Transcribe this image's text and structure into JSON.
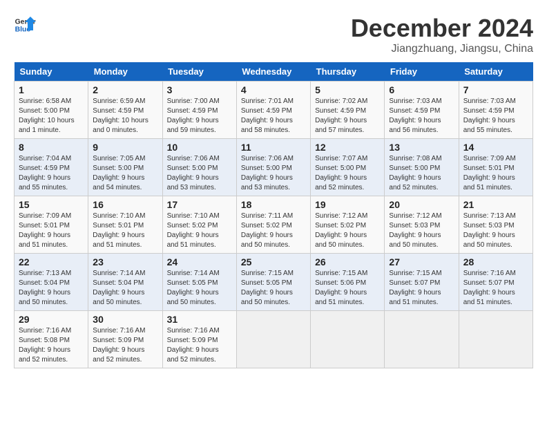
{
  "header": {
    "logo_line1": "General",
    "logo_line2": "Blue",
    "month_title": "December 2024",
    "location": "Jiangzhuang, Jiangsu, China"
  },
  "weekdays": [
    "Sunday",
    "Monday",
    "Tuesday",
    "Wednesday",
    "Thursday",
    "Friday",
    "Saturday"
  ],
  "weeks": [
    [
      {
        "day": "1",
        "sunrise": "Sunrise: 6:58 AM",
        "sunset": "Sunset: 5:00 PM",
        "daylight": "Daylight: 10 hours and 1 minute."
      },
      {
        "day": "2",
        "sunrise": "Sunrise: 6:59 AM",
        "sunset": "Sunset: 4:59 PM",
        "daylight": "Daylight: 10 hours and 0 minutes."
      },
      {
        "day": "3",
        "sunrise": "Sunrise: 7:00 AM",
        "sunset": "Sunset: 4:59 PM",
        "daylight": "Daylight: 9 hours and 59 minutes."
      },
      {
        "day": "4",
        "sunrise": "Sunrise: 7:01 AM",
        "sunset": "Sunset: 4:59 PM",
        "daylight": "Daylight: 9 hours and 58 minutes."
      },
      {
        "day": "5",
        "sunrise": "Sunrise: 7:02 AM",
        "sunset": "Sunset: 4:59 PM",
        "daylight": "Daylight: 9 hours and 57 minutes."
      },
      {
        "day": "6",
        "sunrise": "Sunrise: 7:03 AM",
        "sunset": "Sunset: 4:59 PM",
        "daylight": "Daylight: 9 hours and 56 minutes."
      },
      {
        "day": "7",
        "sunrise": "Sunrise: 7:03 AM",
        "sunset": "Sunset: 4:59 PM",
        "daylight": "Daylight: 9 hours and 55 minutes."
      }
    ],
    [
      {
        "day": "8",
        "sunrise": "Sunrise: 7:04 AM",
        "sunset": "Sunset: 4:59 PM",
        "daylight": "Daylight: 9 hours and 55 minutes."
      },
      {
        "day": "9",
        "sunrise": "Sunrise: 7:05 AM",
        "sunset": "Sunset: 5:00 PM",
        "daylight": "Daylight: 9 hours and 54 minutes."
      },
      {
        "day": "10",
        "sunrise": "Sunrise: 7:06 AM",
        "sunset": "Sunset: 5:00 PM",
        "daylight": "Daylight: 9 hours and 53 minutes."
      },
      {
        "day": "11",
        "sunrise": "Sunrise: 7:06 AM",
        "sunset": "Sunset: 5:00 PM",
        "daylight": "Daylight: 9 hours and 53 minutes."
      },
      {
        "day": "12",
        "sunrise": "Sunrise: 7:07 AM",
        "sunset": "Sunset: 5:00 PM",
        "daylight": "Daylight: 9 hours and 52 minutes."
      },
      {
        "day": "13",
        "sunrise": "Sunrise: 7:08 AM",
        "sunset": "Sunset: 5:00 PM",
        "daylight": "Daylight: 9 hours and 52 minutes."
      },
      {
        "day": "14",
        "sunrise": "Sunrise: 7:09 AM",
        "sunset": "Sunset: 5:01 PM",
        "daylight": "Daylight: 9 hours and 51 minutes."
      }
    ],
    [
      {
        "day": "15",
        "sunrise": "Sunrise: 7:09 AM",
        "sunset": "Sunset: 5:01 PM",
        "daylight": "Daylight: 9 hours and 51 minutes."
      },
      {
        "day": "16",
        "sunrise": "Sunrise: 7:10 AM",
        "sunset": "Sunset: 5:01 PM",
        "daylight": "Daylight: 9 hours and 51 minutes."
      },
      {
        "day": "17",
        "sunrise": "Sunrise: 7:10 AM",
        "sunset": "Sunset: 5:02 PM",
        "daylight": "Daylight: 9 hours and 51 minutes."
      },
      {
        "day": "18",
        "sunrise": "Sunrise: 7:11 AM",
        "sunset": "Sunset: 5:02 PM",
        "daylight": "Daylight: 9 hours and 50 minutes."
      },
      {
        "day": "19",
        "sunrise": "Sunrise: 7:12 AM",
        "sunset": "Sunset: 5:02 PM",
        "daylight": "Daylight: 9 hours and 50 minutes."
      },
      {
        "day": "20",
        "sunrise": "Sunrise: 7:12 AM",
        "sunset": "Sunset: 5:03 PM",
        "daylight": "Daylight: 9 hours and 50 minutes."
      },
      {
        "day": "21",
        "sunrise": "Sunrise: 7:13 AM",
        "sunset": "Sunset: 5:03 PM",
        "daylight": "Daylight: 9 hours and 50 minutes."
      }
    ],
    [
      {
        "day": "22",
        "sunrise": "Sunrise: 7:13 AM",
        "sunset": "Sunset: 5:04 PM",
        "daylight": "Daylight: 9 hours and 50 minutes."
      },
      {
        "day": "23",
        "sunrise": "Sunrise: 7:14 AM",
        "sunset": "Sunset: 5:04 PM",
        "daylight": "Daylight: 9 hours and 50 minutes."
      },
      {
        "day": "24",
        "sunrise": "Sunrise: 7:14 AM",
        "sunset": "Sunset: 5:05 PM",
        "daylight": "Daylight: 9 hours and 50 minutes."
      },
      {
        "day": "25",
        "sunrise": "Sunrise: 7:15 AM",
        "sunset": "Sunset: 5:05 PM",
        "daylight": "Daylight: 9 hours and 50 minutes."
      },
      {
        "day": "26",
        "sunrise": "Sunrise: 7:15 AM",
        "sunset": "Sunset: 5:06 PM",
        "daylight": "Daylight: 9 hours and 51 minutes."
      },
      {
        "day": "27",
        "sunrise": "Sunrise: 7:15 AM",
        "sunset": "Sunset: 5:07 PM",
        "daylight": "Daylight: 9 hours and 51 minutes."
      },
      {
        "day": "28",
        "sunrise": "Sunrise: 7:16 AM",
        "sunset": "Sunset: 5:07 PM",
        "daylight": "Daylight: 9 hours and 51 minutes."
      }
    ],
    [
      {
        "day": "29",
        "sunrise": "Sunrise: 7:16 AM",
        "sunset": "Sunset: 5:08 PM",
        "daylight": "Daylight: 9 hours and 52 minutes."
      },
      {
        "day": "30",
        "sunrise": "Sunrise: 7:16 AM",
        "sunset": "Sunset: 5:09 PM",
        "daylight": "Daylight: 9 hours and 52 minutes."
      },
      {
        "day": "31",
        "sunrise": "Sunrise: 7:16 AM",
        "sunset": "Sunset: 5:09 PM",
        "daylight": "Daylight: 9 hours and 52 minutes."
      },
      null,
      null,
      null,
      null
    ]
  ]
}
